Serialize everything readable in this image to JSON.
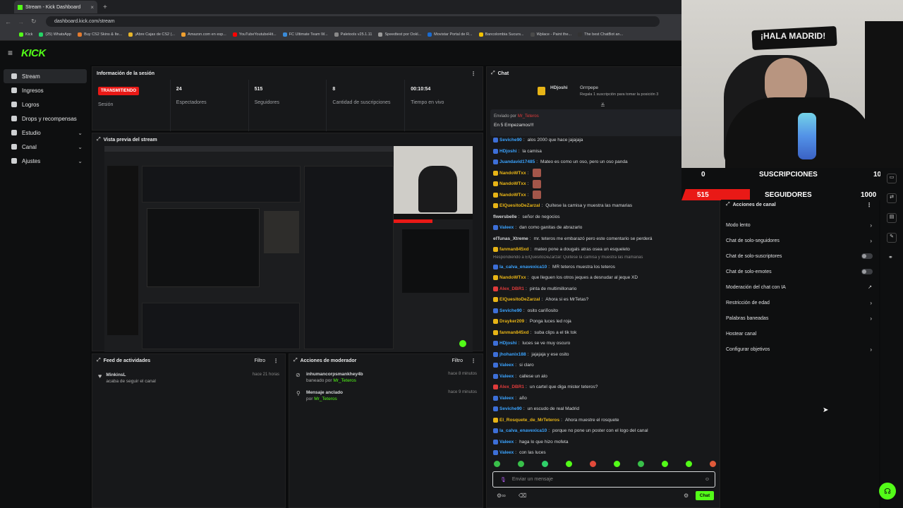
{
  "browser": {
    "tab_title": "Stream - Kick Dashboard",
    "url": "dashboard.kick.com/stream",
    "bookmarks": [
      "Kick",
      "(25) WhatsApp",
      "Buy CS2 Skins & Ite...",
      "¡Abre Cajas de CS2 (...",
      "Amazon.com en esp...",
      "YouTubeYoutubeHit...",
      "FC Ultimate Team W...",
      "Paletools v25.1.11",
      "Speedtest por Ookl...",
      "Movistar Portal de R...",
      "Bancolombia Sucurs...",
      "Wplace - Paint the...",
      "The best ChatBot an..."
    ]
  },
  "brand": {
    "logo": "KICK",
    "accent": "#53fc18"
  },
  "sidebar": {
    "items": [
      {
        "label": "Stream",
        "icon": "stream-icon"
      },
      {
        "label": "Ingresos",
        "icon": "revenue-icon"
      },
      {
        "label": "Logros",
        "icon": "trophy-icon"
      },
      {
        "label": "Drops y recompensas",
        "icon": "gift-icon"
      },
      {
        "label": "Estudio",
        "icon": "studio-icon"
      },
      {
        "label": "Canal",
        "icon": "channel-icon"
      },
      {
        "label": "Ajustes",
        "icon": "gear-icon"
      }
    ]
  },
  "session": {
    "title": "Información de la sesión",
    "live_badge": "TRANSMITIENDO",
    "session_label": "Sesión",
    "stats": [
      {
        "value": "24",
        "label": "Espectadores"
      },
      {
        "value": "515",
        "label": "Seguidores"
      },
      {
        "value": "8",
        "label": "Cantidad de suscripciones"
      },
      {
        "value": "00:10:54",
        "label": "Tiempo en vivo"
      }
    ]
  },
  "preview": {
    "title": "Vista previa del stream"
  },
  "activity": {
    "title": "Feed de actividades",
    "filter": "Filtro",
    "items": [
      {
        "user": "MinkinsL",
        "text": "acaba de seguir el canal",
        "time": "hace 21 horas"
      }
    ]
  },
  "modactions": {
    "title": "Acciones de moderador",
    "filter": "Filtro",
    "items": [
      {
        "title": "inhumancorpsmankhey4b",
        "sub": "baneado por",
        "by": "Mr_Teteros",
        "time": "hace 8 minutos"
      },
      {
        "title": "Mensaje anclado",
        "sub": "por",
        "by": "Mr_Teteros",
        "time": "hace 9 minutos"
      }
    ]
  },
  "chat": {
    "title": "Chat",
    "gift_users": [
      "HDjoshi",
      "Grrrpepe"
    ],
    "gift_text": "Regala 1 suscripción para tomar la posición 3",
    "pinned_by_label": "Enviado por",
    "pinned_by_user": "Mr_Teteros",
    "pinned_text": "En 5 Empezamos!!!",
    "messages": [
      {
        "user": "Seviche90",
        "color": "#3ba4ff",
        "text": "alos 2000 que hace jajajaja"
      },
      {
        "user": "HDjoshi",
        "color": "#3ba4ff",
        "text": "la camisa"
      },
      {
        "user": "Juandavid17485",
        "color": "#3ba4ff",
        "text": "Mateo es como un oso, pero un oso panda"
      },
      {
        "user": "NandoWTxx",
        "color": "#e7b416",
        "text": ""
      },
      {
        "user": "NandoWTxx",
        "color": "#e7b416",
        "text": ""
      },
      {
        "user": "NandoWTxx",
        "color": "#e7b416",
        "text": ""
      },
      {
        "user": "ElQuesitoDeZarzal",
        "color": "#e7b416",
        "text": "Quítese la camisa y muestra las mamarias"
      },
      {
        "user": "flwersbelle",
        "color": "#d6d8da",
        "text": "señor de negocios"
      },
      {
        "user": "Valeex",
        "color": "#3ba4ff",
        "text": "dan como ganitas de abrazarlo"
      },
      {
        "user": "elTunas_Xtreme",
        "color": "#d6d8da",
        "text": "mr. teteros me embarazó pero este comentario se perderá"
      },
      {
        "user": "fanman845xd",
        "color": "#e7b416",
        "text": "mateo pone a dougals atras osea un esqueleto"
      },
      {
        "user": "la_calva_enavexica10",
        "color": "#3ba4ff",
        "text": "MR teteros muestra los teteros"
      },
      {
        "user": "NandoWTxx",
        "color": "#e7b416",
        "text": "que lleguen los otros jeques a desnudar al jeque XD"
      },
      {
        "user": "Alex_DBR1",
        "color": "#e03b3b",
        "text": "pinta de multimillonario"
      },
      {
        "user": "ElQuesitoDeZarzal",
        "color": "#e7b416",
        "text": "Ahora si es MrTetas?"
      },
      {
        "user": "Seviche90",
        "color": "#3ba4ff",
        "text": "osito cariñosito"
      },
      {
        "user": "Drayker209",
        "color": "#e7b416",
        "text": "Ponga luces led roja"
      },
      {
        "user": "fanman845xd",
        "color": "#e7b416",
        "text": "suba clips a el tik tok"
      },
      {
        "user": "HDjoshi",
        "color": "#3ba4ff",
        "text": "luces se ve muy oscuro"
      },
      {
        "user": "jhohanix188",
        "color": "#3ba4ff",
        "text": "jajajaja y ese osito"
      },
      {
        "user": "Valeex",
        "color": "#3ba4ff",
        "text": "si claro"
      },
      {
        "user": "Valeex",
        "color": "#3ba4ff",
        "text": "callese un alo"
      },
      {
        "user": "Alex_DBR1",
        "color": "#e03b3b",
        "text": "un cartel que diga mister teteros?"
      },
      {
        "user": "Valeex",
        "color": "#3ba4ff",
        "text": "año"
      },
      {
        "user": "Seviche90",
        "color": "#3ba4ff",
        "text": "un escudo de real Madrid"
      },
      {
        "user": "El_Rosquete_de_MrTeteros",
        "color": "#e7b416",
        "text": "Ahora muestre el rosquete"
      },
      {
        "user": "la_calva_enavexica10",
        "color": "#3ba4ff",
        "text": "porque no pone un poster con el logo del canal"
      },
      {
        "user": "Valeex",
        "color": "#3ba4ff",
        "text": "haga lo que hizo mofeta"
      },
      {
        "user": "Valeex",
        "color": "#3ba4ff",
        "text": "con las luces"
      }
    ],
    "reply_note": "Respondiendo a ElQuesitoDeZarzal: Quítese la camisa y muestra las mamarias",
    "input_placeholder": "Enviar un mensaje",
    "send_label": "Chat"
  },
  "overlay": {
    "banner": "¡HALA MADRID!",
    "subs_label": "SUSCRIPCIONES",
    "subs_current": "0",
    "subs_goal": "10",
    "subs_progress": 0.0,
    "followers_label": "SEGUIDORES",
    "followers_current": "515",
    "followers_goal": "1000",
    "followers_progress": 0.515
  },
  "channel_actions": {
    "title": "Acciones de canal",
    "items": [
      {
        "label": "Modo lento",
        "control": "chevron"
      },
      {
        "label": "Chat de solo-seguidores",
        "control": "chevron"
      },
      {
        "label": "Chat de solo-suscriptores",
        "control": "toggle"
      },
      {
        "label": "Chat de solo-emotes",
        "control": "toggle"
      },
      {
        "label": "Moderación del chat con IA",
        "control": "external"
      },
      {
        "label": "Restricción de edad",
        "control": "chevron"
      },
      {
        "label": "Palabras baneadas",
        "control": "chevron"
      },
      {
        "label": "Hostear canal",
        "control": "none"
      },
      {
        "label": "Configurar objetivos",
        "control": "chevron"
      }
    ]
  }
}
